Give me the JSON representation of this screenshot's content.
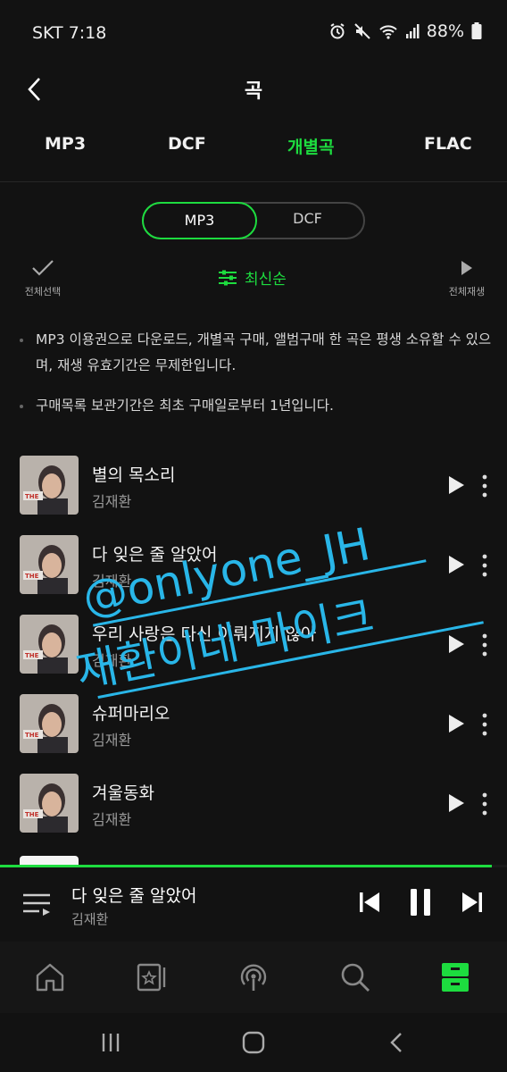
{
  "status": {
    "carrier_time": "SKT 7:18",
    "battery": "88%"
  },
  "header": {
    "title": "곡"
  },
  "tabs": [
    {
      "label": "MP3",
      "active": false
    },
    {
      "label": "DCF",
      "active": false
    },
    {
      "label": "개별곡",
      "active": true
    },
    {
      "label": "FLAC",
      "active": false
    }
  ],
  "segment": {
    "options": [
      "MP3",
      "DCF"
    ],
    "selected": "MP3"
  },
  "toolbar": {
    "select_all": "전체선택",
    "sort": "최신순",
    "play_all": "전체재생"
  },
  "notices": [
    "MP3 이용권으로 다운로드, 개별곡 구매, 앨범구매 한 곡은 평생 소유할 수 있으며, 재생 유효기간은 무제한입니다.",
    "구매목록 보관기간은 최초 구매일로부터 1년입니다."
  ],
  "songs": [
    {
      "title": "별의 목소리",
      "artist": "김재환"
    },
    {
      "title": "다 잊은 줄 알았어",
      "artist": "김재환"
    },
    {
      "title": "우리 사랑은 다신 이뤄지지 않아",
      "artist": "김재환"
    },
    {
      "title": "슈퍼마리오",
      "artist": "김재환"
    },
    {
      "title": "겨울동화",
      "artist": "김재환"
    }
  ],
  "watermark": {
    "line1": "@onlyone_JH",
    "line2": "재환이네 마이크"
  },
  "player": {
    "title": "다 잊은 줄 알았어",
    "artist": "김재환",
    "progress": 0.97
  },
  "colors": {
    "accent": "#1ddc3f",
    "background": "#121212"
  },
  "nav": [
    "home-icon",
    "favorites-icon",
    "podcast-icon",
    "search-icon",
    "storage-icon"
  ]
}
